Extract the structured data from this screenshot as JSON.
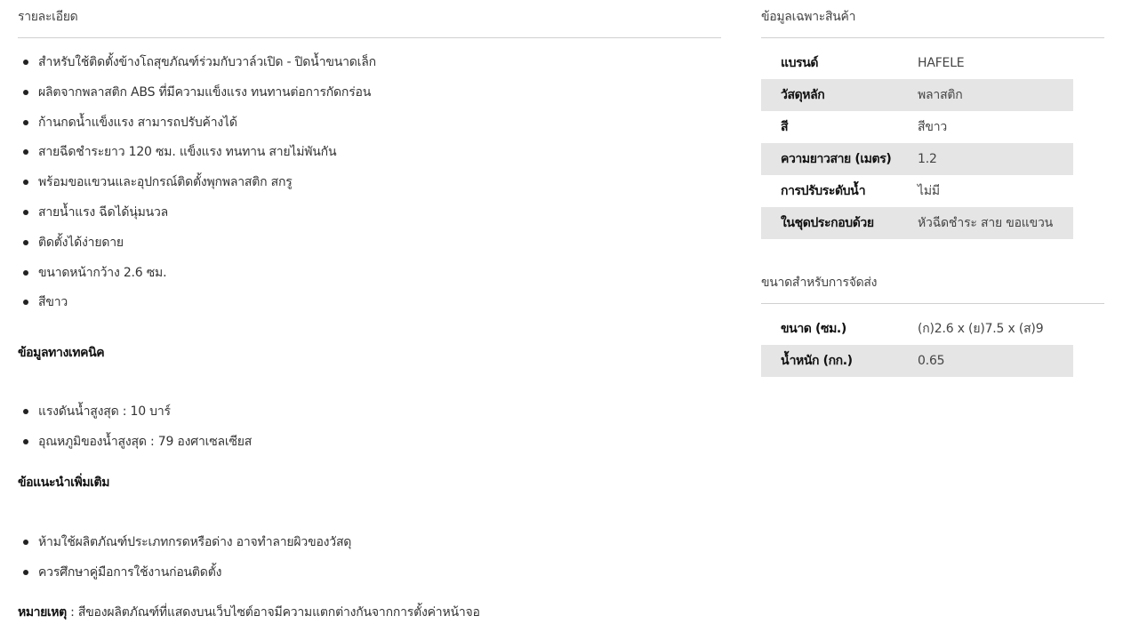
{
  "details": {
    "title": "รายละเอียด",
    "features": [
      "สำหรับใช้ติดตั้งข้างโถสุขภัณฑ์ร่วมกับวาล์วเปิด - ปิดน้ำขนาดเล็ก",
      "ผลิตจากพลาสติก ABS ที่มีความแข็งแรง ทนทานต่อการกัดกร่อน",
      "ก้านกดน้ำแข็งแรง สามารถปรับค้างได้",
      "สายฉีดชำระยาว 120 ซม. แข็งแรง ทนทาน สายไม่พันกัน",
      "พร้อมขอแขวนและอุปกรณ์ติดตั้งพุกพลาสติก สกรู",
      "สายน้ำแรง ฉีดได้นุ่มนวล",
      "ติดตั้งได้ง่ายดาย",
      "ขนาดหน้ากว้าง 2.6 ซม.",
      "สีขาว"
    ],
    "tech_heading": "ข้อมูลทางเทคนิค",
    "tech": [
      "แรงดันน้ำสูงสุด : 10 บาร์",
      "อุณหภูมิของน้ำสูงสุด : 79 องศาเซลเซียส"
    ],
    "advice_heading": "ข้อแนะนำเพิ่มเติม",
    "advice": [
      "ห้ามใช้ผลิตภัณฑ์ประเภทกรดหรือด่าง อาจทำลายผิวของวัสดุ",
      "ควรศึกษาคู่มือการใช้งานก่อนติดตั้ง"
    ],
    "note_label": "หมายเหตุ",
    "note_text": " : สีของผลิตภัณฑ์ที่แสดงบนเว็บไซต์อาจมีความแตกต่างกันจากการตั้งค่าหน้าจอ"
  },
  "specs": {
    "title": "ข้อมูลเฉพาะสินค้า",
    "rows": [
      {
        "key": "แบรนด์",
        "value": "HAFELE"
      },
      {
        "key": "วัสดุหลัก",
        "value": "พลาสติก"
      },
      {
        "key": "สี",
        "value": "สีขาว"
      },
      {
        "key": "ความยาวสาย (เมตร)",
        "value": "1.2"
      },
      {
        "key": "การปรับระดับน้ำ",
        "value": "ไม่มี"
      },
      {
        "key": "ในชุดประกอบด้วย",
        "value": "หัวฉีดชำระ สาย ขอแขวน"
      }
    ]
  },
  "shipping": {
    "title": "ขนาดสำหรับการจัดส่ง",
    "rows": [
      {
        "key": "ขนาด (ซม.)",
        "value": "(ก)2.6 x (ย)7.5 x (ส)9"
      },
      {
        "key": "น้ำหนัก (กก.)",
        "value": "0.65"
      }
    ]
  }
}
